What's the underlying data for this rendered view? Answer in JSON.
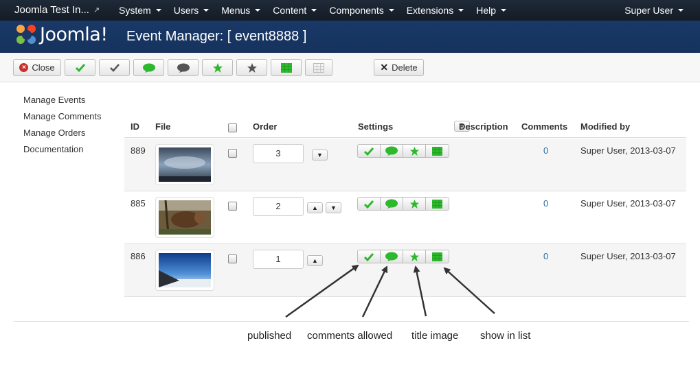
{
  "navbar": {
    "site_name": "Joomla Test In...",
    "menu": [
      "System",
      "Users",
      "Menus",
      "Content",
      "Components",
      "Extensions",
      "Help"
    ],
    "user": "Super User"
  },
  "header": {
    "logo_text": "Joomla!",
    "page_title": "Event Manager: [ event8888 ]"
  },
  "toolbar": {
    "close_label": "Close",
    "delete_label": "Delete"
  },
  "sidebar": {
    "items": [
      "Manage Events",
      "Manage Comments",
      "Manage Orders",
      "Documentation"
    ]
  },
  "table": {
    "columns": {
      "id": "ID",
      "file": "File",
      "order": "Order",
      "settings": "Settings",
      "description": "Description",
      "comments": "Comments",
      "modified_by": "Modified by"
    },
    "rows": [
      {
        "id": "889",
        "order": "3",
        "comments": "0",
        "modified_by": "Super User, 2013-03-07",
        "has_up": false,
        "has_down": true,
        "thumb": "sky"
      },
      {
        "id": "885",
        "order": "2",
        "comments": "0",
        "modified_by": "Super User, 2013-03-07",
        "has_up": true,
        "has_down": true,
        "thumb": "animal"
      },
      {
        "id": "886",
        "order": "1",
        "comments": "0",
        "modified_by": "Super User, 2013-03-07",
        "has_up": true,
        "has_down": false,
        "thumb": "wing"
      }
    ]
  },
  "annotations": [
    "published",
    "comments allowed",
    "title image",
    "show in list"
  ],
  "colors": {
    "accent_green": "#2db82d",
    "link_blue": "#2a6aa5",
    "nav_dark": "#17202b",
    "header_blue": "#1a3867"
  }
}
